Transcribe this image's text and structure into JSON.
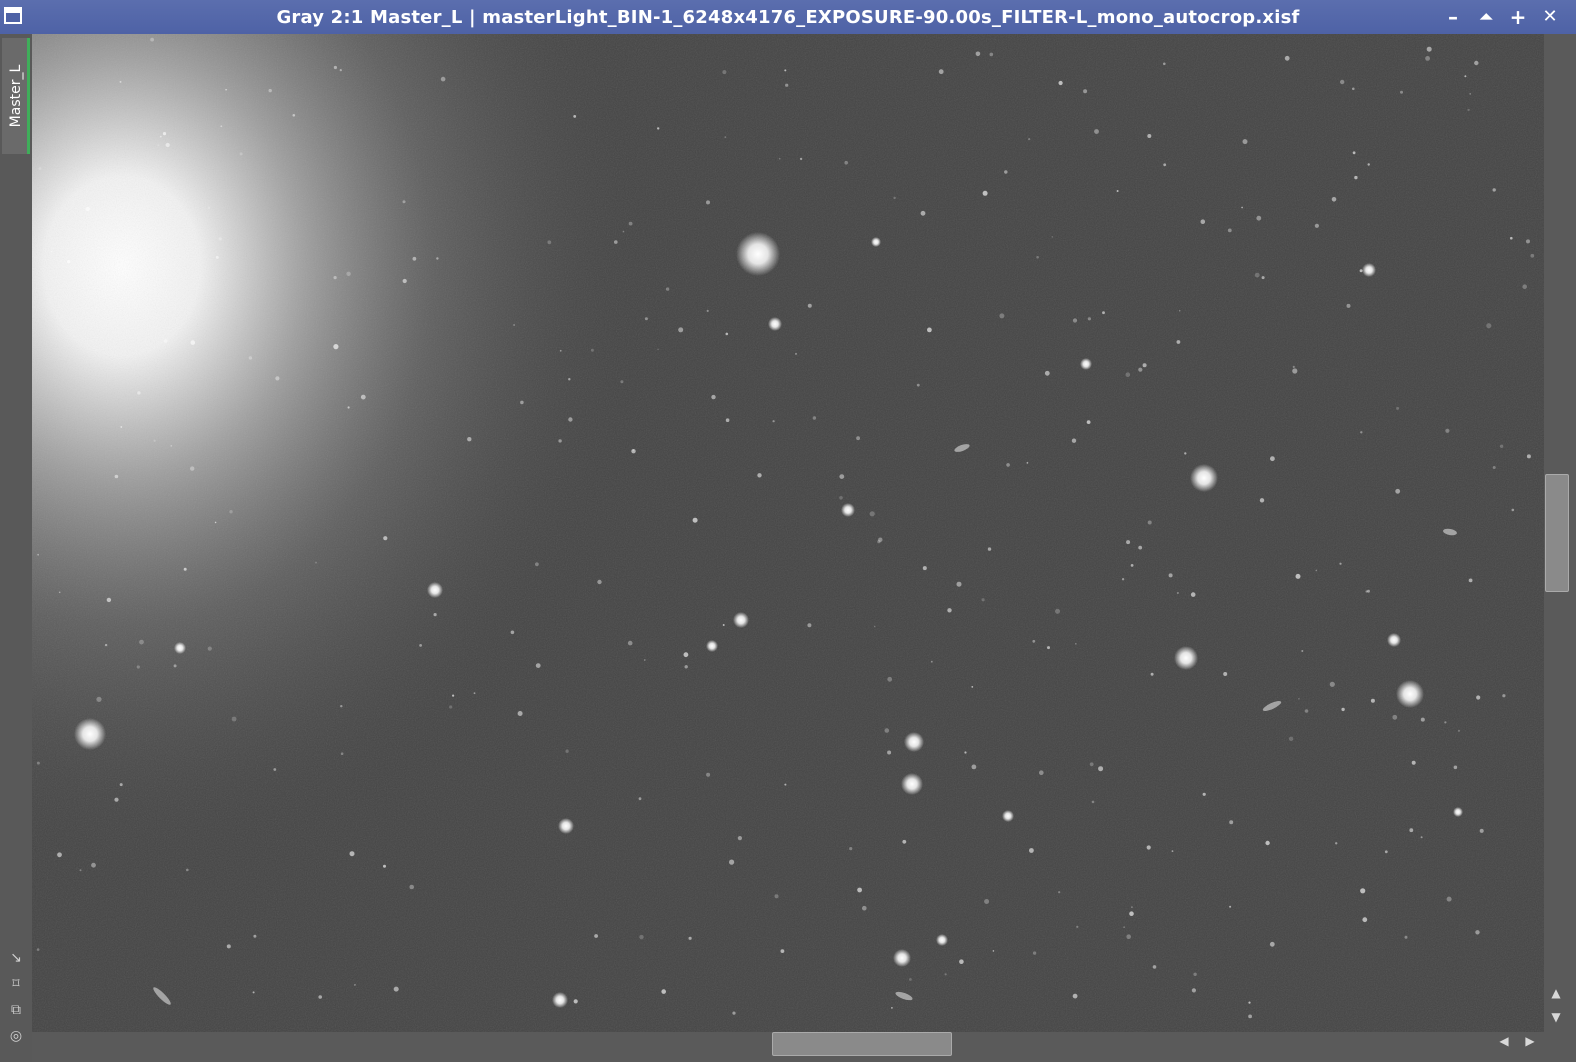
{
  "window": {
    "title": "Gray 2:1 Master_L | masterLight_BIN-1_6248x4176_EXPOSURE-90.00s_FILTER-L_mono_autocrop.xisf",
    "icon": "window-icon",
    "buttons": {
      "minimize": "–",
      "shade": "⏶",
      "maximize": "+",
      "close": "✕"
    }
  },
  "sidebar": {
    "tab_label": "Master_L",
    "tools": [
      {
        "icon": "arrow-diagonal-icon",
        "glyph": "↘"
      },
      {
        "icon": "fit-view-icon",
        "glyph": "⌑"
      },
      {
        "icon": "clone-icon",
        "glyph": "⧉"
      },
      {
        "icon": "target-icon",
        "glyph": "◎"
      }
    ]
  },
  "image": {
    "description_type": "astronomical grayscale image",
    "colors": {
      "background": "#474747",
      "title_bar": "#4e62a6",
      "tab_accent": "#3fae5a"
    }
  },
  "scrollbars": {
    "vertical": {
      "up": "▲",
      "down": "▼",
      "position_fraction": 0.44
    },
    "horizontal": {
      "left": "◀",
      "right": "▶",
      "position_fraction": 0.48
    }
  }
}
